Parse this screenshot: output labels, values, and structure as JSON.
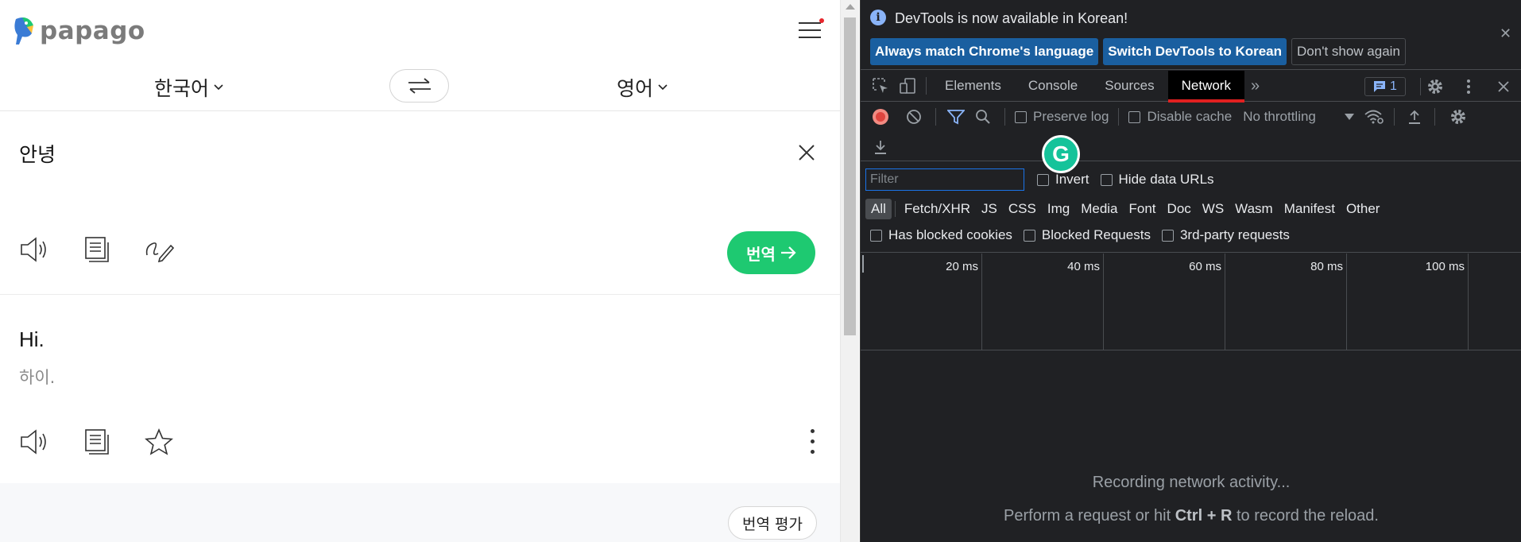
{
  "papago": {
    "brand": "papago",
    "colors": {
      "accent_green": "#1ec971",
      "logo_blue": "#3a7bd5",
      "logo_yellow": "#ffc23b"
    },
    "source_lang": "한국어",
    "target_lang": "영어",
    "source_text": "안녕",
    "translate_button": "번역",
    "result_text": "Hi.",
    "result_pronunciation": "하이.",
    "rate_button": "번역 평가",
    "icons": [
      "speaker-icon",
      "copy-icon",
      "handwrite-icon",
      "star-icon",
      "more-vertical-icon",
      "swap-icon",
      "close-icon",
      "hamburger-menu-icon"
    ]
  },
  "devtools": {
    "info_text": "DevTools is now available in Korean!",
    "info_buttons": [
      "Always match Chrome's language",
      "Switch DevTools to Korean",
      "Don't show again"
    ],
    "tabs": [
      "Elements",
      "Console",
      "Sources",
      "Network"
    ],
    "active_tab": "Network",
    "issues_count": "1",
    "toolbar": {
      "preserve_log": "Preserve log",
      "disable_cache": "Disable cache",
      "throttling": "No throttling"
    },
    "filter": {
      "placeholder": "Filter",
      "invert": "Invert",
      "hide_data_urls": "Hide data URLs",
      "types": [
        "All",
        "Fetch/XHR",
        "JS",
        "CSS",
        "Img",
        "Media",
        "Font",
        "Doc",
        "WS",
        "Wasm",
        "Manifest",
        "Other"
      ],
      "active_type": "All",
      "has_blocked_cookies": "Has blocked cookies",
      "blocked_requests": "Blocked Requests",
      "third_party": "3rd-party requests"
    },
    "timeline_labels": [
      "20 ms",
      "40 ms",
      "60 ms",
      "80 ms",
      "100 ms"
    ],
    "empty_title": "Recording network activity...",
    "empty_hint_prefix": "Perform a request or hit",
    "empty_hint_keys": "Ctrl + R",
    "empty_hint_suffix": "to record the reload.",
    "colors": {
      "record_red": "#f28b82",
      "filter_blue": "#8ab4f8",
      "active_tab_underline": "#e02020"
    }
  },
  "grammarly_badge": "G"
}
